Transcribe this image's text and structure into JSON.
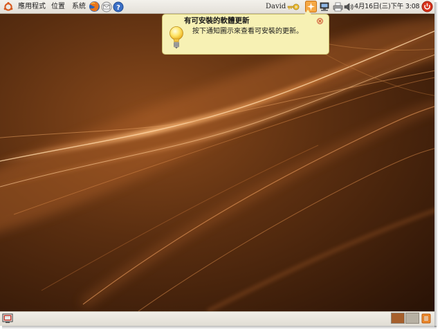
{
  "top_panel": {
    "menus": [
      {
        "label": "應用程式"
      },
      {
        "label": "位置"
      },
      {
        "label": "系統"
      }
    ],
    "launchers": [
      "firefox-icon",
      "mail-icon",
      "help-icon"
    ],
    "user_name": "David",
    "tray_icons": [
      "key-icon",
      "update-notifier-icon",
      "network-icon",
      "printer-icon",
      "volume-icon"
    ],
    "clock": "4月16日(三)下午 3:08",
    "power_icon": "power-icon"
  },
  "notification": {
    "title": "有可安裝的軟體更新",
    "body": "按下通知圖示來查看可安裝的更新。",
    "icon": "lightbulb-icon",
    "close_icon": "close-icon"
  },
  "bottom_panel": {
    "show_desktop_icon": "show-desktop-icon",
    "workspaces": [
      {
        "name": "workspace-1",
        "active": true,
        "color": "#a65f2c"
      },
      {
        "name": "workspace-2",
        "active": false,
        "color": "#b7b0a3"
      }
    ],
    "trash_icon": "trash-icon"
  },
  "colors": {
    "wallpaper_dark": "#3a1d08",
    "wallpaper_light": "#c8773a",
    "notification_bg": "#f7f1b4",
    "accent": "#e07010"
  }
}
